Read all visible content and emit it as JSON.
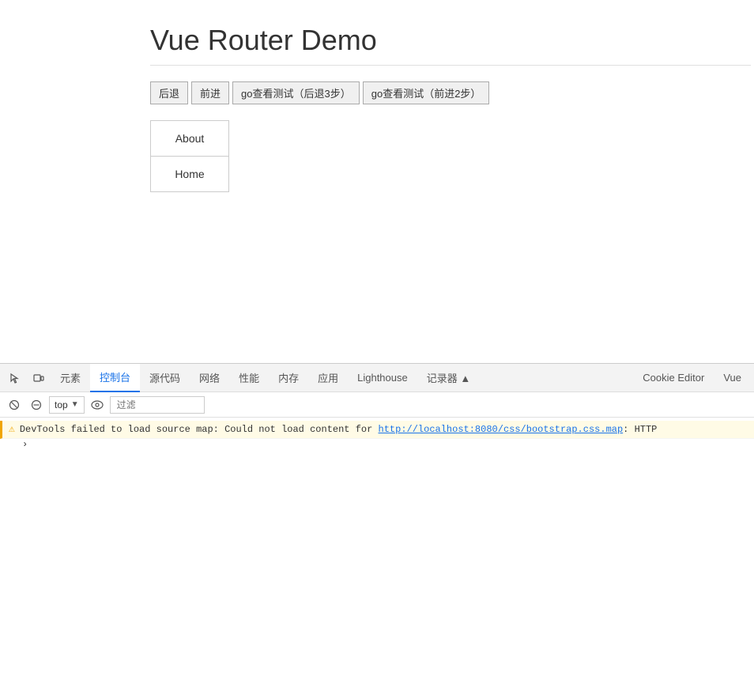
{
  "main": {
    "title": "Vue Router Demo",
    "buttons": [
      {
        "label": "后退",
        "id": "back"
      },
      {
        "label": "前进",
        "id": "forward"
      },
      {
        "label": "go查看测试（后退3步）",
        "id": "go-back-3"
      },
      {
        "label": "go查看测试（前进2步）",
        "id": "go-forward-2"
      }
    ],
    "nav_items": [
      {
        "label": "About"
      },
      {
        "label": "Home"
      }
    ]
  },
  "devtools": {
    "tabs": [
      {
        "label": "元素",
        "id": "elements",
        "active": false
      },
      {
        "label": "控制台",
        "id": "console",
        "active": true
      },
      {
        "label": "源代码",
        "id": "sources",
        "active": false
      },
      {
        "label": "网络",
        "id": "network",
        "active": false
      },
      {
        "label": "性能",
        "id": "performance",
        "active": false
      },
      {
        "label": "内存",
        "id": "memory",
        "active": false
      },
      {
        "label": "应用",
        "id": "application",
        "active": false
      },
      {
        "label": "Lighthouse",
        "id": "lighthouse",
        "active": false
      },
      {
        "label": "记录器 ▲",
        "id": "recorder",
        "active": false
      },
      {
        "label": "Cookie Editor",
        "id": "cookie-editor",
        "active": false
      },
      {
        "label": "Vue",
        "id": "vue",
        "active": false
      }
    ],
    "toolbar": {
      "top_label": "top",
      "filter_placeholder": "过滤"
    },
    "console_messages": [
      {
        "type": "warning",
        "text_before": "DevTools failed to load source map: Could not load content for ",
        "link": "http://localhost:8080/css/bootstrap.css.map",
        "text_after": ": HTTP"
      }
    ],
    "continuation": "›"
  }
}
